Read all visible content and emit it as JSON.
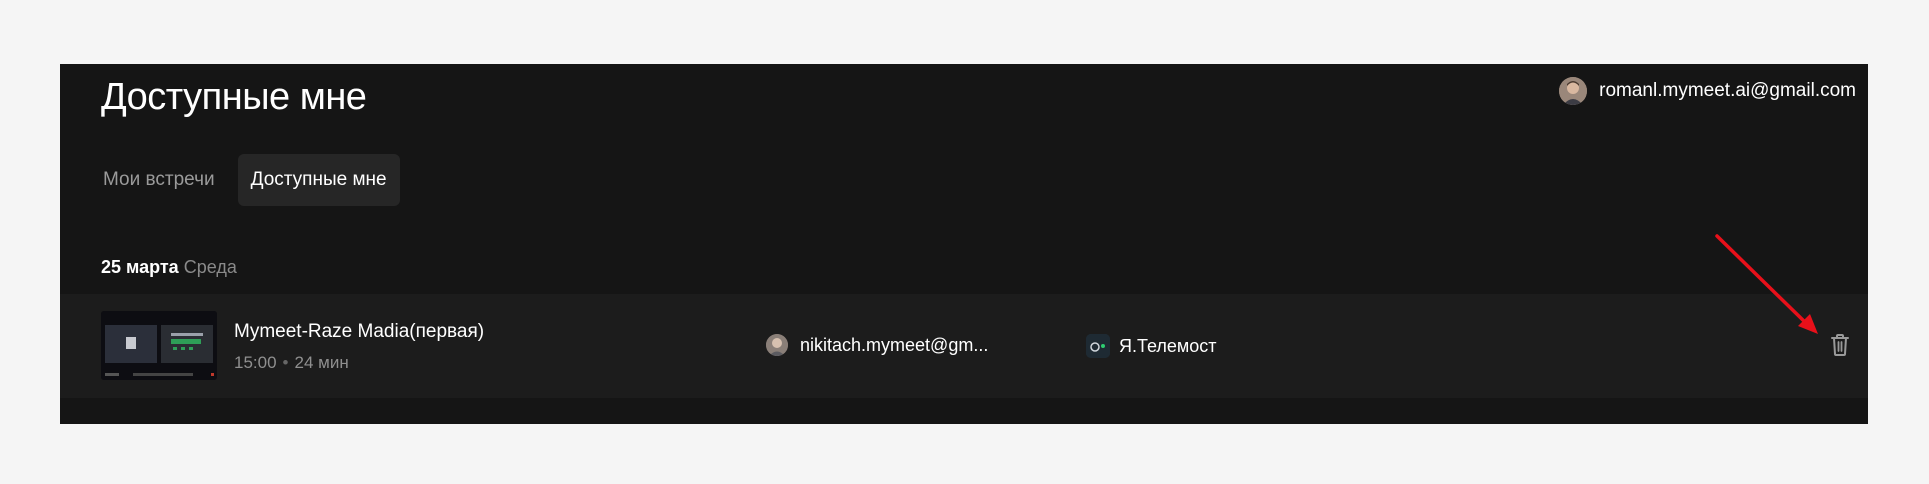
{
  "header": {
    "title": "Доступные мне",
    "user_email": "romanl.mymeet.ai@gmail.com"
  },
  "tabs": [
    {
      "label": "Мои встречи",
      "active": false
    },
    {
      "label": "Доступные мне",
      "active": true
    }
  ],
  "date_group": {
    "day": "25 марта",
    "weekday": "Среда"
  },
  "meeting": {
    "title": "Mymeet-Raze Madia(первая)",
    "time": "15:00",
    "duration": "24 мин",
    "owner_email": "nikitach.mymeet@gm...",
    "platform": "Я.Телемост",
    "delete_icon": "trash-icon"
  },
  "colors": {
    "panel_bg": "#151515",
    "row_bg": "#1c1c1c",
    "active_tab_bg": "#262626",
    "annotation_arrow": "#e8101a"
  }
}
